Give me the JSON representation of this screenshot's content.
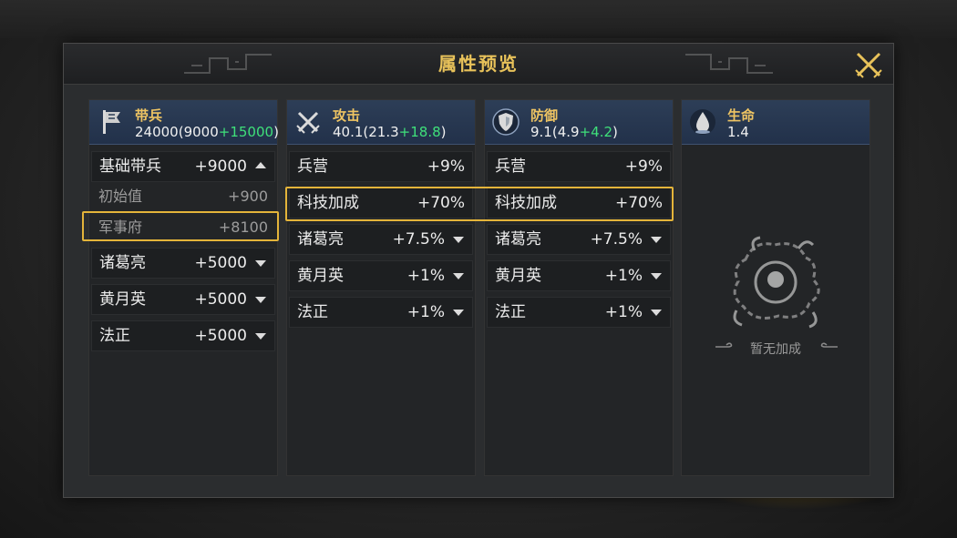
{
  "dialog": {
    "title": "属性预览"
  },
  "columns": [
    {
      "icon": "troops-flag-icon",
      "title": "带兵",
      "total": "24000",
      "base": "9000",
      "bonus": "+15000",
      "rows": [
        {
          "label": "基础带兵",
          "value": "+9000"
        },
        {
          "label": "初始值",
          "value": "+900"
        },
        {
          "label": "军事府",
          "value": "+8100"
        },
        {
          "label": "诸葛亮",
          "value": "+5000"
        },
        {
          "label": "黄月英",
          "value": "+5000"
        },
        {
          "label": "法正",
          "value": "+5000"
        }
      ]
    },
    {
      "icon": "crossed-swords-icon",
      "title": "攻击",
      "total": "40.1",
      "base": "21.3",
      "bonus": "+18.8",
      "rows": [
        {
          "label": "兵营",
          "value": "+9%"
        },
        {
          "label": "科技加成",
          "value": "+70%"
        },
        {
          "label": "诸葛亮",
          "value": "+7.5%"
        },
        {
          "label": "黄月英",
          "value": "+1%"
        },
        {
          "label": "法正",
          "value": "+1%"
        }
      ]
    },
    {
      "icon": "shield-icon",
      "title": "防御",
      "total": "9.1",
      "base": "4.9",
      "bonus": "+4.2",
      "rows": [
        {
          "label": "兵营",
          "value": "+9%"
        },
        {
          "label": "科技加成",
          "value": "+70%"
        },
        {
          "label": "诸葛亮",
          "value": "+7.5%"
        },
        {
          "label": "黄月英",
          "value": "+1%"
        },
        {
          "label": "法正",
          "value": "+1%"
        }
      ]
    },
    {
      "icon": "blood-drop-icon",
      "title": "生命",
      "total": "1.4",
      "empty_text": "暂无加成"
    }
  ],
  "colors": {
    "title_gold": "#e8c25a",
    "bonus_green": "#3fe07a",
    "highlight": "#e4b43a",
    "header_blue": "#2d3e57"
  }
}
